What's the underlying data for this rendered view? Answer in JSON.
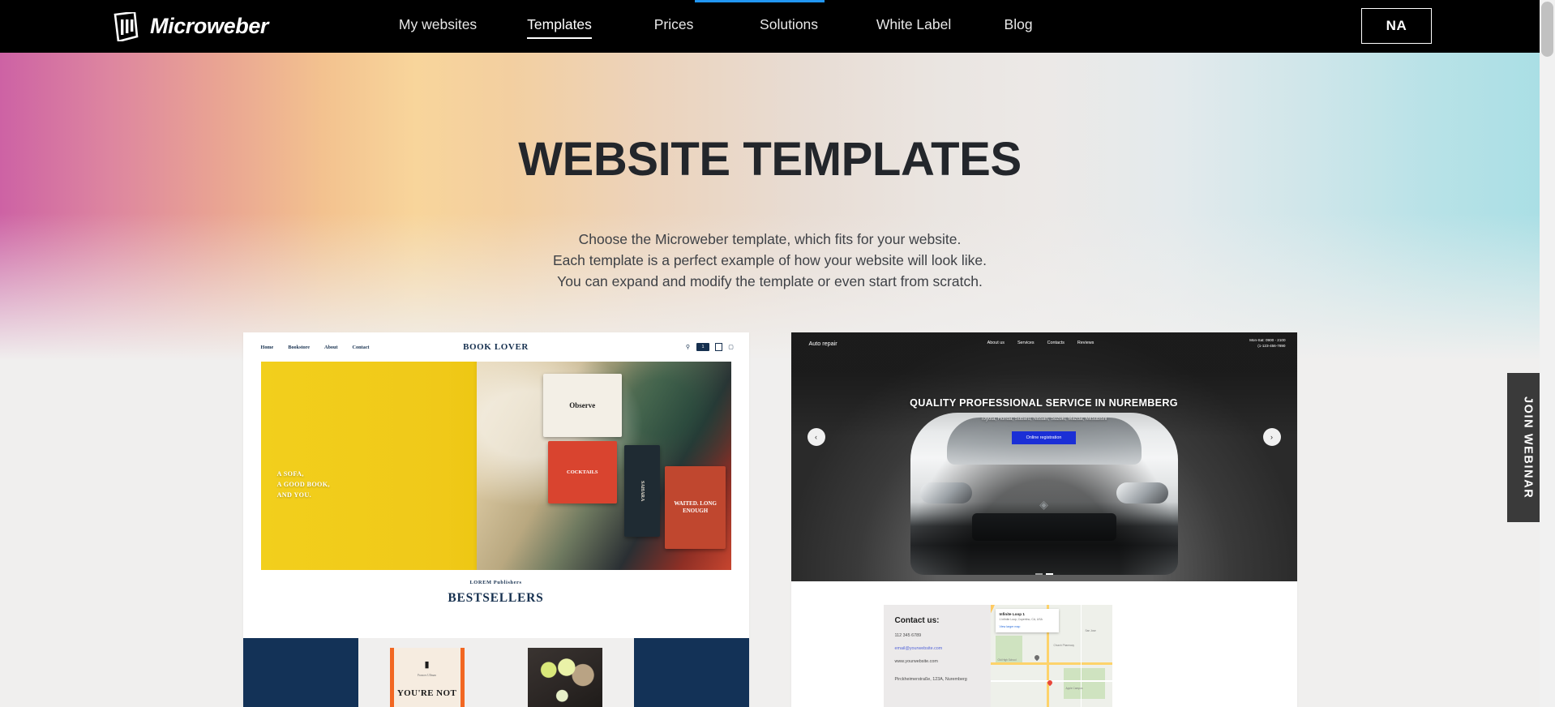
{
  "topbar": {
    "brand": "Microweber",
    "nav": [
      {
        "label": "My websites",
        "active": false
      },
      {
        "label": "Templates",
        "active": true
      },
      {
        "label": "Prices",
        "active": false
      },
      {
        "label": "Solutions",
        "active": false
      },
      {
        "label": "White Label",
        "active": false
      },
      {
        "label": "Blog",
        "active": false
      }
    ],
    "account_button": "NA",
    "accent_color": "#2196f3",
    "background_color": "#000000"
  },
  "hero": {
    "title": "WEBSITE TEMPLATES",
    "line1": "Choose the Microweber template, which fits for your website.",
    "line2": "Each template is a perfect example of how your website will look like.",
    "line3": "You can expand and modify the template or even start from scratch.",
    "gradient_from": "#cd62a4",
    "gradient_mid": "#f8d59b",
    "gradient_to": "#aadfe5"
  },
  "sidetab": {
    "label": "JOIN WEBINAR",
    "background_color": "#3a3a3a"
  },
  "templates": [
    {
      "name": "book-lover",
      "nav": [
        "Home",
        "Bookstore",
        "About",
        "Contact"
      ],
      "logo": "BOOK LOVER",
      "icons": [
        "search-icon",
        "cart-badge",
        "wishlist-icon",
        "account-icon"
      ],
      "cart_badge": "1",
      "hero_claim_line1": "A SOFA,",
      "hero_claim_line2": "A GOOD BOOK,",
      "hero_claim_line3": "AND YOU.",
      "magazines": [
        "Observe",
        "COCKTAILS",
        "SAHARA",
        "WAITED. LONG ENOUGH"
      ],
      "publisher": "LOREM Publishers",
      "section_title": "BESTSELLERS",
      "book1_author": "Frances Ullman",
      "book1_title": "YOU'RE NOT",
      "accent_navy": "#133257",
      "accent_yellow": "#f2cf1c"
    },
    {
      "name": "auto-repair",
      "brand": "Auto repair",
      "nav": [
        "About us",
        "Services",
        "Contacts",
        "Reviews"
      ],
      "hours_line1": "Mon-Sat: 0900 - 2100",
      "hours_line2": "(1-123-456-7890",
      "hero_title": "QUALITY PROFESSIONAL SERVICE IN NUREMBERG",
      "hero_subtitle": "Toyota, Honda, Subaru, Nissan, Suzuki, Mazda, Mitsubishi",
      "cta": "Online registration",
      "prev_arrow": "‹",
      "next_arrow": "›",
      "dots": 2,
      "active_dot": 1,
      "contact_title": "Contact us:",
      "contact_phone": "112 345 6789",
      "contact_email": "email@yourwebsite.com",
      "contact_site": "www.yourwebsite.com",
      "contact_address": "Pirckheimerstraße, 123A, Nuremberg",
      "map_card_title": "Infinite Loop 1",
      "map_card_sub": "1 Infinite Loop, Cupertino, CA, USA",
      "map_card_link": "View larger map",
      "map_labels": [
        "Church Pharmacy",
        "San Jose",
        "Old High School",
        "Apple Campus"
      ],
      "cta_color": "#1b2fd6"
    }
  ]
}
